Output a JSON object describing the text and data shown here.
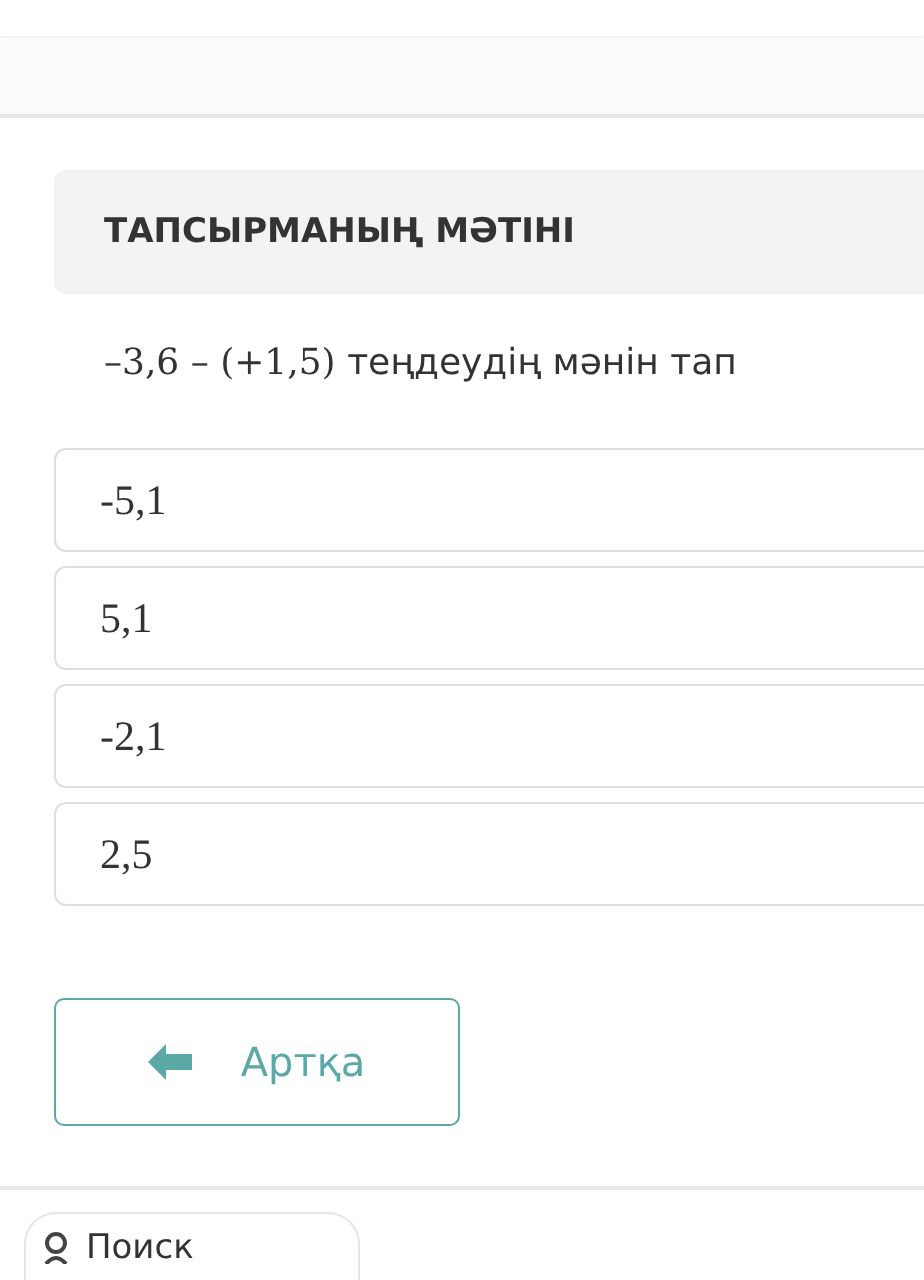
{
  "task": {
    "heading": "ТАПСЫРМАНЫҢ МӘТІНІ",
    "question": {
      "formula": "–3,6 – (+1,5)",
      "text": "теңдеудің мәнін тап"
    },
    "options": [
      "-5,1",
      "5,1",
      "-2,1",
      "2,5"
    ]
  },
  "back_button": {
    "label": "Артқа"
  },
  "search": {
    "placeholder": "Поиск"
  }
}
